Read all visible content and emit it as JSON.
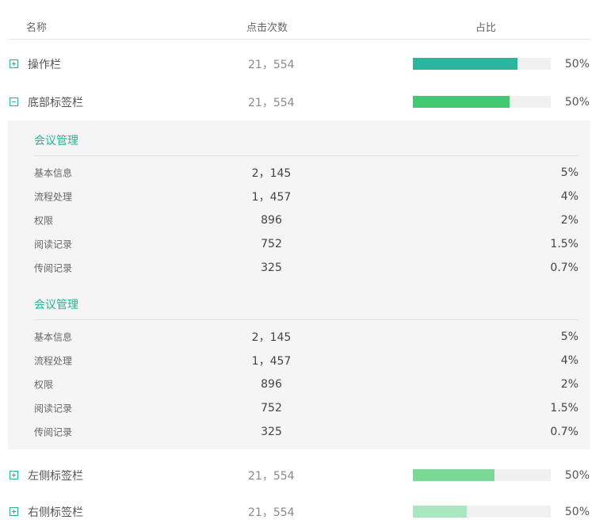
{
  "header": {
    "name": "名称",
    "count": "点击次数",
    "ratio": "占比"
  },
  "rows": [
    {
      "label": "操作栏",
      "count": "21，554",
      "pct": "50%",
      "bar_fill": 0.76,
      "bar_color": "#2bb59f",
      "expanded": false
    },
    {
      "label": "底部标签栏",
      "count": "21，554",
      "pct": "50%",
      "bar_fill": 0.7,
      "bar_color": "#45c874",
      "expanded": true
    },
    {
      "label": "左侧标签栏",
      "count": "21，554",
      "pct": "50%",
      "bar_fill": 0.59,
      "bar_color": "#7bd895",
      "expanded": false
    },
    {
      "label": "右侧标签栏",
      "count": "21，554",
      "pct": "50%",
      "bar_fill": 0.39,
      "bar_color": "#a8e7bf",
      "expanded": false
    }
  ],
  "detail": {
    "groups": [
      {
        "title": "会议管理",
        "items": [
          {
            "label": "基本信息",
            "count": "2，145",
            "pct": "5%"
          },
          {
            "label": "流程处理",
            "count": "1，457",
            "pct": "4%"
          },
          {
            "label": "权限",
            "count": "896",
            "pct": "2%"
          },
          {
            "label": "阅读记录",
            "count": "752",
            "pct": "1.5%"
          },
          {
            "label": "传阅记录",
            "count": "325",
            "pct": "0.7%"
          }
        ]
      },
      {
        "title": "会议管理",
        "items": [
          {
            "label": "基本信息",
            "count": "2，145",
            "pct": "5%"
          },
          {
            "label": "流程处理",
            "count": "1，457",
            "pct": "4%"
          },
          {
            "label": "权限",
            "count": "896",
            "pct": "2%"
          },
          {
            "label": "阅读记录",
            "count": "752",
            "pct": "1.5%"
          },
          {
            "label": "传阅记录",
            "count": "325",
            "pct": "0.7%"
          }
        ]
      }
    ]
  }
}
